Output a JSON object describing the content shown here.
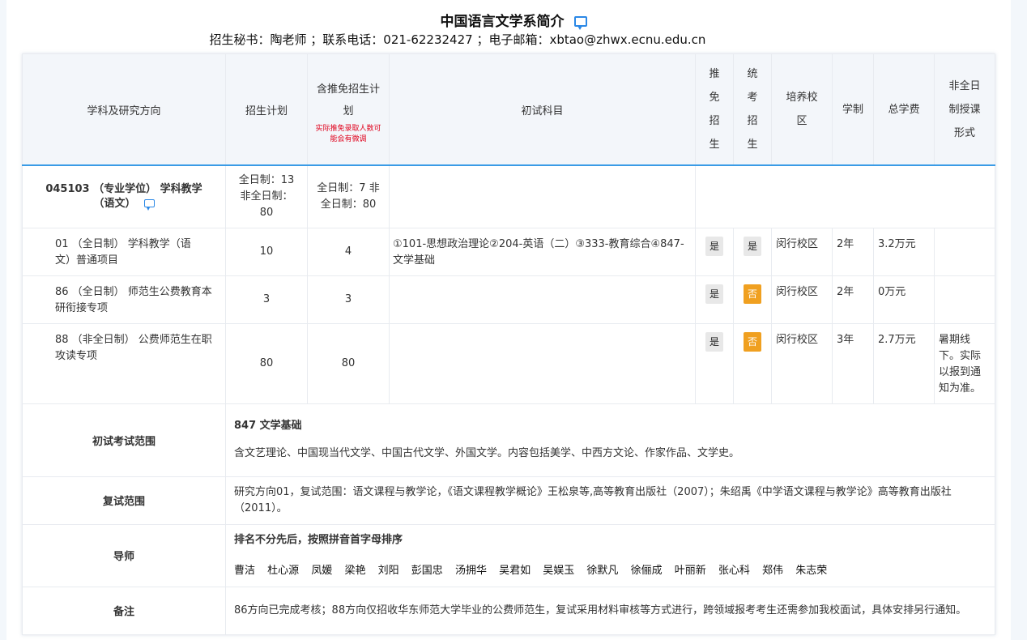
{
  "header": {
    "title": "中国语言文学系简介",
    "contact": "招生秘书：陶老师 ；联系电话：021-62232427 ；电子邮箱：xbtao@zhwx.ecnu.edu.cn"
  },
  "columns": {
    "subject": "学科及研究方向",
    "plan": "招生计划",
    "plan_with_exempt": "含推免招生计划",
    "plan_note": "实际推免录取人数可能会有微调",
    "exam": "初试科目",
    "exempt": "推免招生",
    "unified": "统考招生",
    "campus": "培养校区",
    "duration": "学制",
    "fee": "总学费",
    "parttime": "非全日制授课形式"
  },
  "major": {
    "name": "045103 （专业学位） 学科教学（语文）",
    "plan": "全日制：13 非全日制：80",
    "plan_exempt": "全日制：7 非全日制：80"
  },
  "rows": [
    {
      "direction": "01 （全日制） 学科教学（语文）普通项目",
      "plan": "10",
      "plan_exempt": "4",
      "exam": "①101-思想政治理论②204-英语（二）③333-教育综合④847-文学基础",
      "exempt": "是",
      "unified": "是",
      "campus": "闵行校区",
      "duration": "2年",
      "fee": "3.2万元",
      "parttime": ""
    },
    {
      "direction": "86 （全日制） 师范生公费教育本研衔接专项",
      "plan": "3",
      "plan_exempt": "3",
      "exam": "",
      "exempt": "是",
      "unified": "否",
      "campus": "闵行校区",
      "duration": "2年",
      "fee": "0万元",
      "parttime": ""
    },
    {
      "direction": "88 （非全日制） 公费师范生在职攻读专项",
      "plan": "80",
      "plan_exempt": "80",
      "exam": "",
      "exempt": "是",
      "unified": "否",
      "campus": "闵行校区",
      "duration": "3年",
      "fee": "2.7万元",
      "parttime": "暑期线下。实际以报到通知为准。"
    }
  ],
  "details": {
    "exam_scope_label": "初试考试范围",
    "exam_scope_title": "847 文学基础",
    "exam_scope_text": "含文艺理论、中国现当代文学、中国古代文学、外国文学。内容包括美学、中西方文论、作家作品、文学史。",
    "retest_label": "复试范围",
    "retest_text": "研究方向01，复试范围：语文课程与教学论，《语文课程教学概论》王松泉等,高等教育出版社（2007）；朱绍禹《中学语文课程与教学论》高等教育出版社（2011）。",
    "tutor_label": "导师",
    "tutor_note": "排名不分先后，按照拼音首字母排序",
    "tutors": [
      "曹洁",
      "杜心源",
      "凤媛",
      "梁艳",
      "刘阳",
      "彭国忠",
      "汤拥华",
      "吴君如",
      "吴娱玉",
      "徐默凡",
      "徐俪成",
      "叶丽新",
      "张心科",
      "郑伟",
      "朱志荣"
    ],
    "remark_label": "备注",
    "remark_text": "86方向已完成考核；88方向仅招收华东师范大学毕业的公费师范生，复试采用材料审核等方式进行，跨领域报考考生还需参加我校面试，具体安排另行通知。"
  },
  "icons": {
    "comment": "comment-icon"
  },
  "colors": {
    "accent": "#3a9be6",
    "no_badge": "#f0a020",
    "note_red": "#e0001b"
  }
}
